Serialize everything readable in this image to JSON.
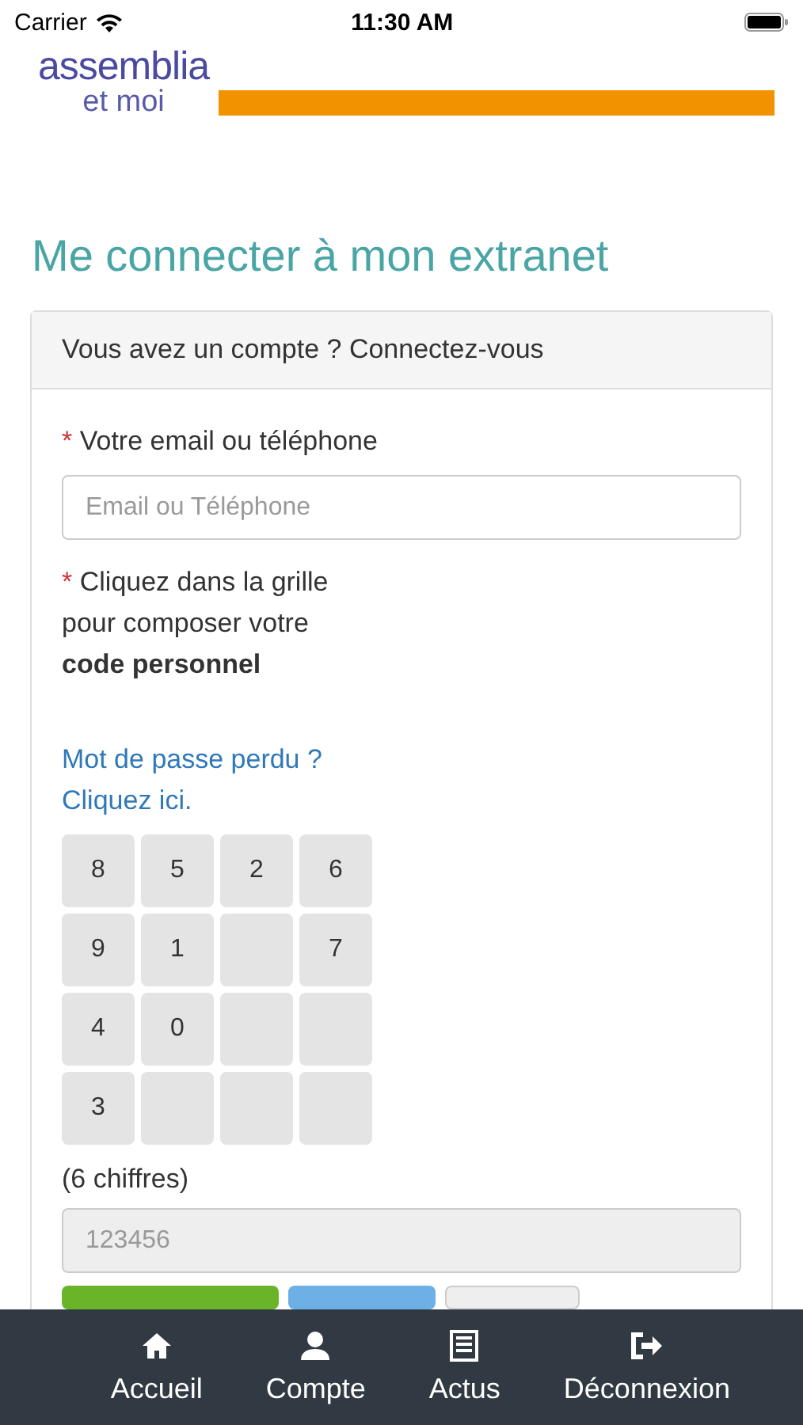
{
  "status_bar": {
    "carrier": "Carrier",
    "time": "11:30 AM"
  },
  "logo": {
    "name": "assemblia",
    "tagline": "et moi"
  },
  "page_title": "Me connecter à mon extranet",
  "panel": {
    "heading": "Vous avez un compte ? Connectez-vous",
    "email_mark": "*",
    "email_label": "Votre email ou téléphone",
    "email_placeholder": "Email ou Téléphone",
    "code_label_lines": [
      "Cliquez dans la grille",
      "pour composer votre"
    ],
    "code_label_bold": "code personnel",
    "code_mark": "*",
    "lost_password_links": [
      "Mot de passe perdu ?",
      "Cliquez ici."
    ],
    "keypad": [
      {
        "kind": "digit",
        "label": "8"
      },
      {
        "kind": "digit",
        "label": "5"
      },
      {
        "kind": "digit",
        "label": "2"
      },
      {
        "kind": "digit",
        "label": "6"
      },
      {
        "kind": "digit",
        "label": "9"
      },
      {
        "kind": "digit",
        "label": "1"
      },
      {
        "kind": "blank"
      },
      {
        "kind": "digit",
        "label": "7"
      },
      {
        "kind": "digit",
        "label": "4"
      },
      {
        "kind": "digit",
        "label": "0"
      },
      {
        "kind": "blank"
      },
      {
        "kind": "blank"
      },
      {
        "kind": "digit",
        "label": "3"
      },
      {
        "kind": "blank"
      },
      {
        "kind": "blank"
      },
      {
        "kind": "blank"
      }
    ],
    "digits_hint": "(6 chiffres)",
    "code_placeholder": "123456",
    "buttons": [
      {
        "kind": "primary"
      },
      {
        "kind": "info"
      },
      {
        "kind": "default"
      }
    ]
  },
  "tab_bar": [
    {
      "label": "Accueil"
    },
    {
      "label": "Compte"
    },
    {
      "label": "Actus"
    },
    {
      "label": "Déconnexion"
    }
  ]
}
